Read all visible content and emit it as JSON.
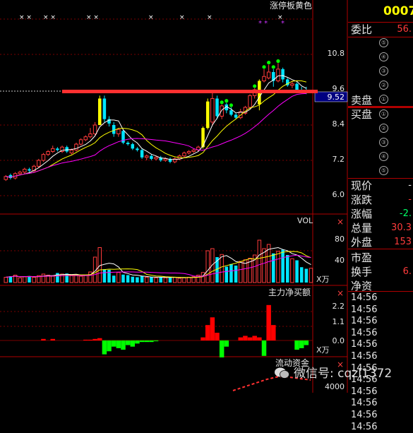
{
  "main_chart": {
    "indicator_title": "涨停板黄色",
    "axis_ticks": [
      "10.8",
      "9.6",
      "8.4",
      "7.2",
      "6.0"
    ],
    "current_price_tag": "9.52",
    "resistance_line_price": 9.52,
    "candles": [
      {
        "o": 6.55,
        "c": 6.65,
        "h": 6.7,
        "l": 6.5
      },
      {
        "o": 6.7,
        "c": 6.6,
        "h": 6.75,
        "l": 6.55
      },
      {
        "o": 6.6,
        "c": 6.75,
        "h": 6.8,
        "l": 6.55
      },
      {
        "o": 6.75,
        "c": 6.8,
        "h": 6.85,
        "l": 6.7
      },
      {
        "o": 6.8,
        "c": 6.9,
        "h": 6.95,
        "l": 6.75
      },
      {
        "o": 6.9,
        "c": 6.85,
        "h": 6.95,
        "l": 6.8
      },
      {
        "o": 6.85,
        "c": 7.0,
        "h": 7.05,
        "l": 6.8
      },
      {
        "o": 7.0,
        "c": 7.2,
        "h": 7.25,
        "l": 6.95
      },
      {
        "o": 7.2,
        "c": 7.4,
        "h": 7.45,
        "l": 7.15
      },
      {
        "o": 7.4,
        "c": 7.5,
        "h": 7.55,
        "l": 7.35
      },
      {
        "o": 7.5,
        "c": 7.6,
        "h": 7.7,
        "l": 7.45
      },
      {
        "o": 7.6,
        "c": 7.55,
        "h": 7.65,
        "l": 7.5
      },
      {
        "o": 7.5,
        "c": 7.65,
        "h": 7.7,
        "l": 7.45
      },
      {
        "o": 7.65,
        "c": 7.5,
        "h": 7.7,
        "l": 7.45
      },
      {
        "o": 7.45,
        "c": 7.55,
        "h": 7.6,
        "l": 7.4
      },
      {
        "o": 7.55,
        "c": 7.75,
        "h": 7.8,
        "l": 7.5
      },
      {
        "o": 7.75,
        "c": 7.9,
        "h": 7.95,
        "l": 7.7
      },
      {
        "o": 7.9,
        "c": 8.0,
        "h": 8.05,
        "l": 7.85
      },
      {
        "o": 8.0,
        "c": 8.1,
        "h": 8.3,
        "l": 7.95
      },
      {
        "o": 8.1,
        "c": 8.4,
        "h": 8.5,
        "l": 8.05
      },
      {
        "o": 8.4,
        "c": 9.3,
        "h": 9.4,
        "l": 8.4,
        "limit": true
      },
      {
        "o": 9.3,
        "c": 8.6,
        "h": 9.4,
        "l": 8.5
      },
      {
        "o": 8.6,
        "c": 8.45,
        "h": 8.7,
        "l": 8.35
      },
      {
        "o": 8.4,
        "c": 8.1,
        "h": 8.5,
        "l": 8.0
      },
      {
        "o": 8.1,
        "c": 8.25,
        "h": 8.3,
        "l": 8.0
      },
      {
        "o": 8.2,
        "c": 7.8,
        "h": 8.25,
        "l": 7.75
      },
      {
        "o": 7.8,
        "c": 7.75,
        "h": 7.85,
        "l": 7.7
      },
      {
        "o": 7.75,
        "c": 7.6,
        "h": 7.8,
        "l": 7.55
      },
      {
        "o": 7.6,
        "c": 7.55,
        "h": 7.65,
        "l": 7.5
      },
      {
        "o": 7.55,
        "c": 7.3,
        "h": 7.6,
        "l": 7.25
      },
      {
        "o": 7.3,
        "c": 7.35,
        "h": 7.4,
        "l": 7.2
      },
      {
        "o": 7.35,
        "c": 7.25,
        "h": 7.4,
        "l": 7.2
      },
      {
        "o": 7.25,
        "c": 7.3,
        "h": 7.35,
        "l": 7.2
      },
      {
        "o": 7.3,
        "c": 7.2,
        "h": 7.35,
        "l": 7.15
      },
      {
        "o": 7.2,
        "c": 7.25,
        "h": 7.3,
        "l": 7.15
      },
      {
        "o": 7.25,
        "c": 7.15,
        "h": 7.3,
        "l": 7.1
      },
      {
        "o": 7.15,
        "c": 7.25,
        "h": 7.3,
        "l": 7.1
      },
      {
        "o": 7.25,
        "c": 7.35,
        "h": 7.4,
        "l": 7.2
      },
      {
        "o": 7.35,
        "c": 7.45,
        "h": 7.5,
        "l": 7.3
      },
      {
        "o": 7.45,
        "c": 7.5,
        "h": 7.55,
        "l": 7.4
      },
      {
        "o": 7.5,
        "c": 7.55,
        "h": 7.6,
        "l": 7.45
      },
      {
        "o": 7.55,
        "c": 7.65,
        "h": 7.7,
        "l": 7.5
      },
      {
        "o": 7.65,
        "c": 8.3,
        "h": 8.35,
        "l": 7.6,
        "limit": true
      },
      {
        "o": 8.3,
        "c": 9.2,
        "h": 9.3,
        "l": 8.25,
        "limit": true
      },
      {
        "o": 8.5,
        "c": 9.3,
        "h": 9.6,
        "l": 8.4
      },
      {
        "o": 9.3,
        "c": 8.7,
        "h": 9.4,
        "l": 8.6
      },
      {
        "o": 8.7,
        "c": 9.05,
        "h": 9.1,
        "l": 8.6
      },
      {
        "o": 9.1,
        "c": 8.9,
        "h": 9.15,
        "l": 8.8
      },
      {
        "o": 8.9,
        "c": 8.75,
        "h": 9.0,
        "l": 8.7
      },
      {
        "o": 8.75,
        "c": 8.65,
        "h": 8.8,
        "l": 8.6
      },
      {
        "o": 8.65,
        "c": 8.85,
        "h": 8.95,
        "l": 8.6
      },
      {
        "o": 8.8,
        "c": 9.0,
        "h": 9.05,
        "l": 8.75
      },
      {
        "o": 9.0,
        "c": 9.4,
        "h": 9.45,
        "l": 8.95
      },
      {
        "o": 9.4,
        "c": 9.6,
        "h": 9.65,
        "l": 9.3
      },
      {
        "o": 9.1,
        "c": 9.9,
        "h": 9.95,
        "l": 8.9,
        "limit": true
      },
      {
        "o": 9.9,
        "c": 10.05,
        "h": 10.3,
        "l": 9.85
      },
      {
        "o": 10.0,
        "c": 10.2,
        "h": 10.45,
        "l": 9.95
      },
      {
        "o": 10.2,
        "c": 9.9,
        "h": 10.3,
        "l": 9.7
      },
      {
        "o": 9.9,
        "c": 10.3,
        "h": 10.5,
        "l": 9.85
      },
      {
        "o": 10.3,
        "c": 9.95,
        "h": 10.35,
        "l": 9.85
      },
      {
        "o": 9.95,
        "c": 9.75,
        "h": 10.0,
        "l": 9.7
      },
      {
        "o": 9.75,
        "c": 9.8,
        "h": 9.9,
        "l": 9.65
      },
      {
        "o": 9.8,
        "c": 9.6,
        "h": 9.85,
        "l": 9.5
      },
      {
        "o": 9.6,
        "c": 9.55,
        "h": 9.7,
        "l": 9.5
      },
      {
        "o": 9.55,
        "c": 9.52,
        "h": 9.7,
        "l": 9.45
      }
    ]
  },
  "volume_chart": {
    "title": "VOL",
    "axis_ticks": [
      "80",
      "40"
    ],
    "unit": "X万",
    "bars": [
      10,
      12,
      14,
      9,
      11,
      12,
      10,
      13,
      16,
      14,
      12,
      18,
      16,
      17,
      13,
      14,
      12,
      14,
      20,
      48,
      66,
      25,
      24,
      13,
      19,
      15,
      14,
      11,
      10,
      12,
      10,
      10,
      9,
      10,
      9,
      10,
      10,
      8,
      9,
      10,
      11,
      14,
      19,
      60,
      64,
      48,
      53,
      30,
      35,
      32,
      40,
      43,
      46,
      52,
      80,
      64,
      72,
      55,
      59,
      62,
      52,
      45,
      42,
      29,
      26,
      27
    ]
  },
  "capital_chart": {
    "title": "主力净买额",
    "axis_ticks": [
      "2.2",
      "1.1",
      "0.0"
    ],
    "unit": "X万",
    "bars": [
      0,
      0,
      0,
      0,
      0,
      0,
      0,
      0,
      0.1,
      0,
      0.1,
      0,
      0,
      0,
      0,
      0,
      0,
      0.05,
      0.05,
      0.1,
      0.15,
      -0.9,
      -0.7,
      -0.4,
      -0.5,
      -0.6,
      -0.3,
      -0.4,
      -0.2,
      -0.1,
      -0.1,
      -0.1,
      -0.05,
      0,
      0,
      0,
      0,
      0,
      0,
      0,
      0,
      0,
      0.2,
      1.0,
      1.5,
      0.5,
      -1.1,
      -0.4,
      0,
      0,
      0.2,
      0.3,
      0.2,
      0.3,
      0.2,
      -1.0,
      2.3,
      1.0,
      0,
      0,
      0,
      0,
      -0.6,
      -0.5,
      -0.3,
      0
    ]
  },
  "flow_chart": {
    "title": "流动资金",
    "axis_ticks": [
      "4000"
    ]
  },
  "side_panel": {
    "code": "0007",
    "weibi_label": "委比",
    "weibi_value": "56.",
    "sell_label": "卖盘",
    "buy_label": "买盘",
    "sell_levels": [
      "⑤",
      "④",
      "③",
      "②",
      "①"
    ],
    "buy_levels": [
      "①",
      "②",
      "③",
      "④",
      "⑤"
    ],
    "rows": [
      {
        "label": "现价",
        "value": "-"
      },
      {
        "label": "涨跌",
        "value": "-"
      },
      {
        "label": "涨幅",
        "value": "-2."
      },
      {
        "label": "总量",
        "value": "30.3"
      },
      {
        "label": "外盘",
        "value": "153"
      },
      {
        "label": "市盈",
        "value": ""
      },
      {
        "label": "换手",
        "value": "6."
      },
      {
        "label": "净资",
        "value": ""
      }
    ],
    "times": [
      "14:56",
      "14:56",
      "14:56",
      "14:56",
      "14:56",
      "14:56",
      "14:56",
      "14:56",
      "14:56",
      "14:56",
      "14:56",
      "14:56"
    ]
  },
  "watermark": "微信号: cqzl1372",
  "colors": {
    "up": "#ff3b3b",
    "down": "#00e5ff",
    "limit": "#ffff00",
    "grid": "#b00000",
    "ma5": "#ffffff",
    "ma10": "#ffff00",
    "ma20": "#ff00ff",
    "resist": "#ff3030",
    "buy": "#ff0000",
    "sell": "#00ff00"
  }
}
